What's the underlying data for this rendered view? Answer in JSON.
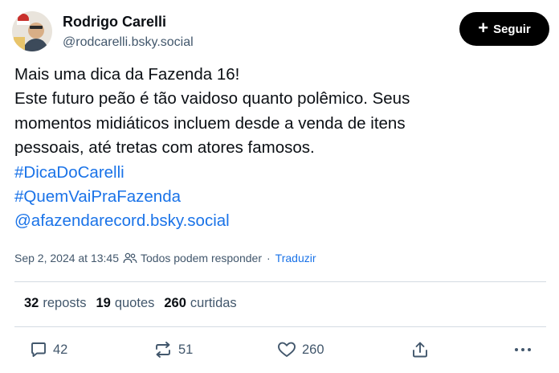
{
  "author": {
    "name": "Rodrigo Carelli",
    "handle": "@rodcarelli.bsky.social"
  },
  "follow_button": {
    "label": "Seguir"
  },
  "post": {
    "lines": [
      "Mais uma dica da Fazenda 16!",
      "Este futuro peão é tão vaidoso quanto polêmico. Seus",
      "momentos midiáticos incluem desde a venda de itens",
      "pessoais, até tretas com atores famosos."
    ],
    "hashtag_1": "#DicaDoCarelli",
    "hashtag_2": "#QuemVaiPraFazenda",
    "mention": "@afazendarecord.bsky.social"
  },
  "meta": {
    "timestamp": "Sep 2, 2024 at 13:45",
    "reply_setting": "Todos podem responder",
    "separator": "·",
    "translate": "Traduzir"
  },
  "stats": {
    "reposts_count": "32",
    "reposts_label": "reposts",
    "quotes_count": "19",
    "quotes_label": "quotes",
    "likes_count": "260",
    "likes_label": "curtidas"
  },
  "actions": {
    "reply_count": "42",
    "repost_count": "51",
    "like_count": "260"
  },
  "colors": {
    "link": "#1a73e8",
    "muted": "#42576c",
    "follow_bg": "#000000"
  }
}
